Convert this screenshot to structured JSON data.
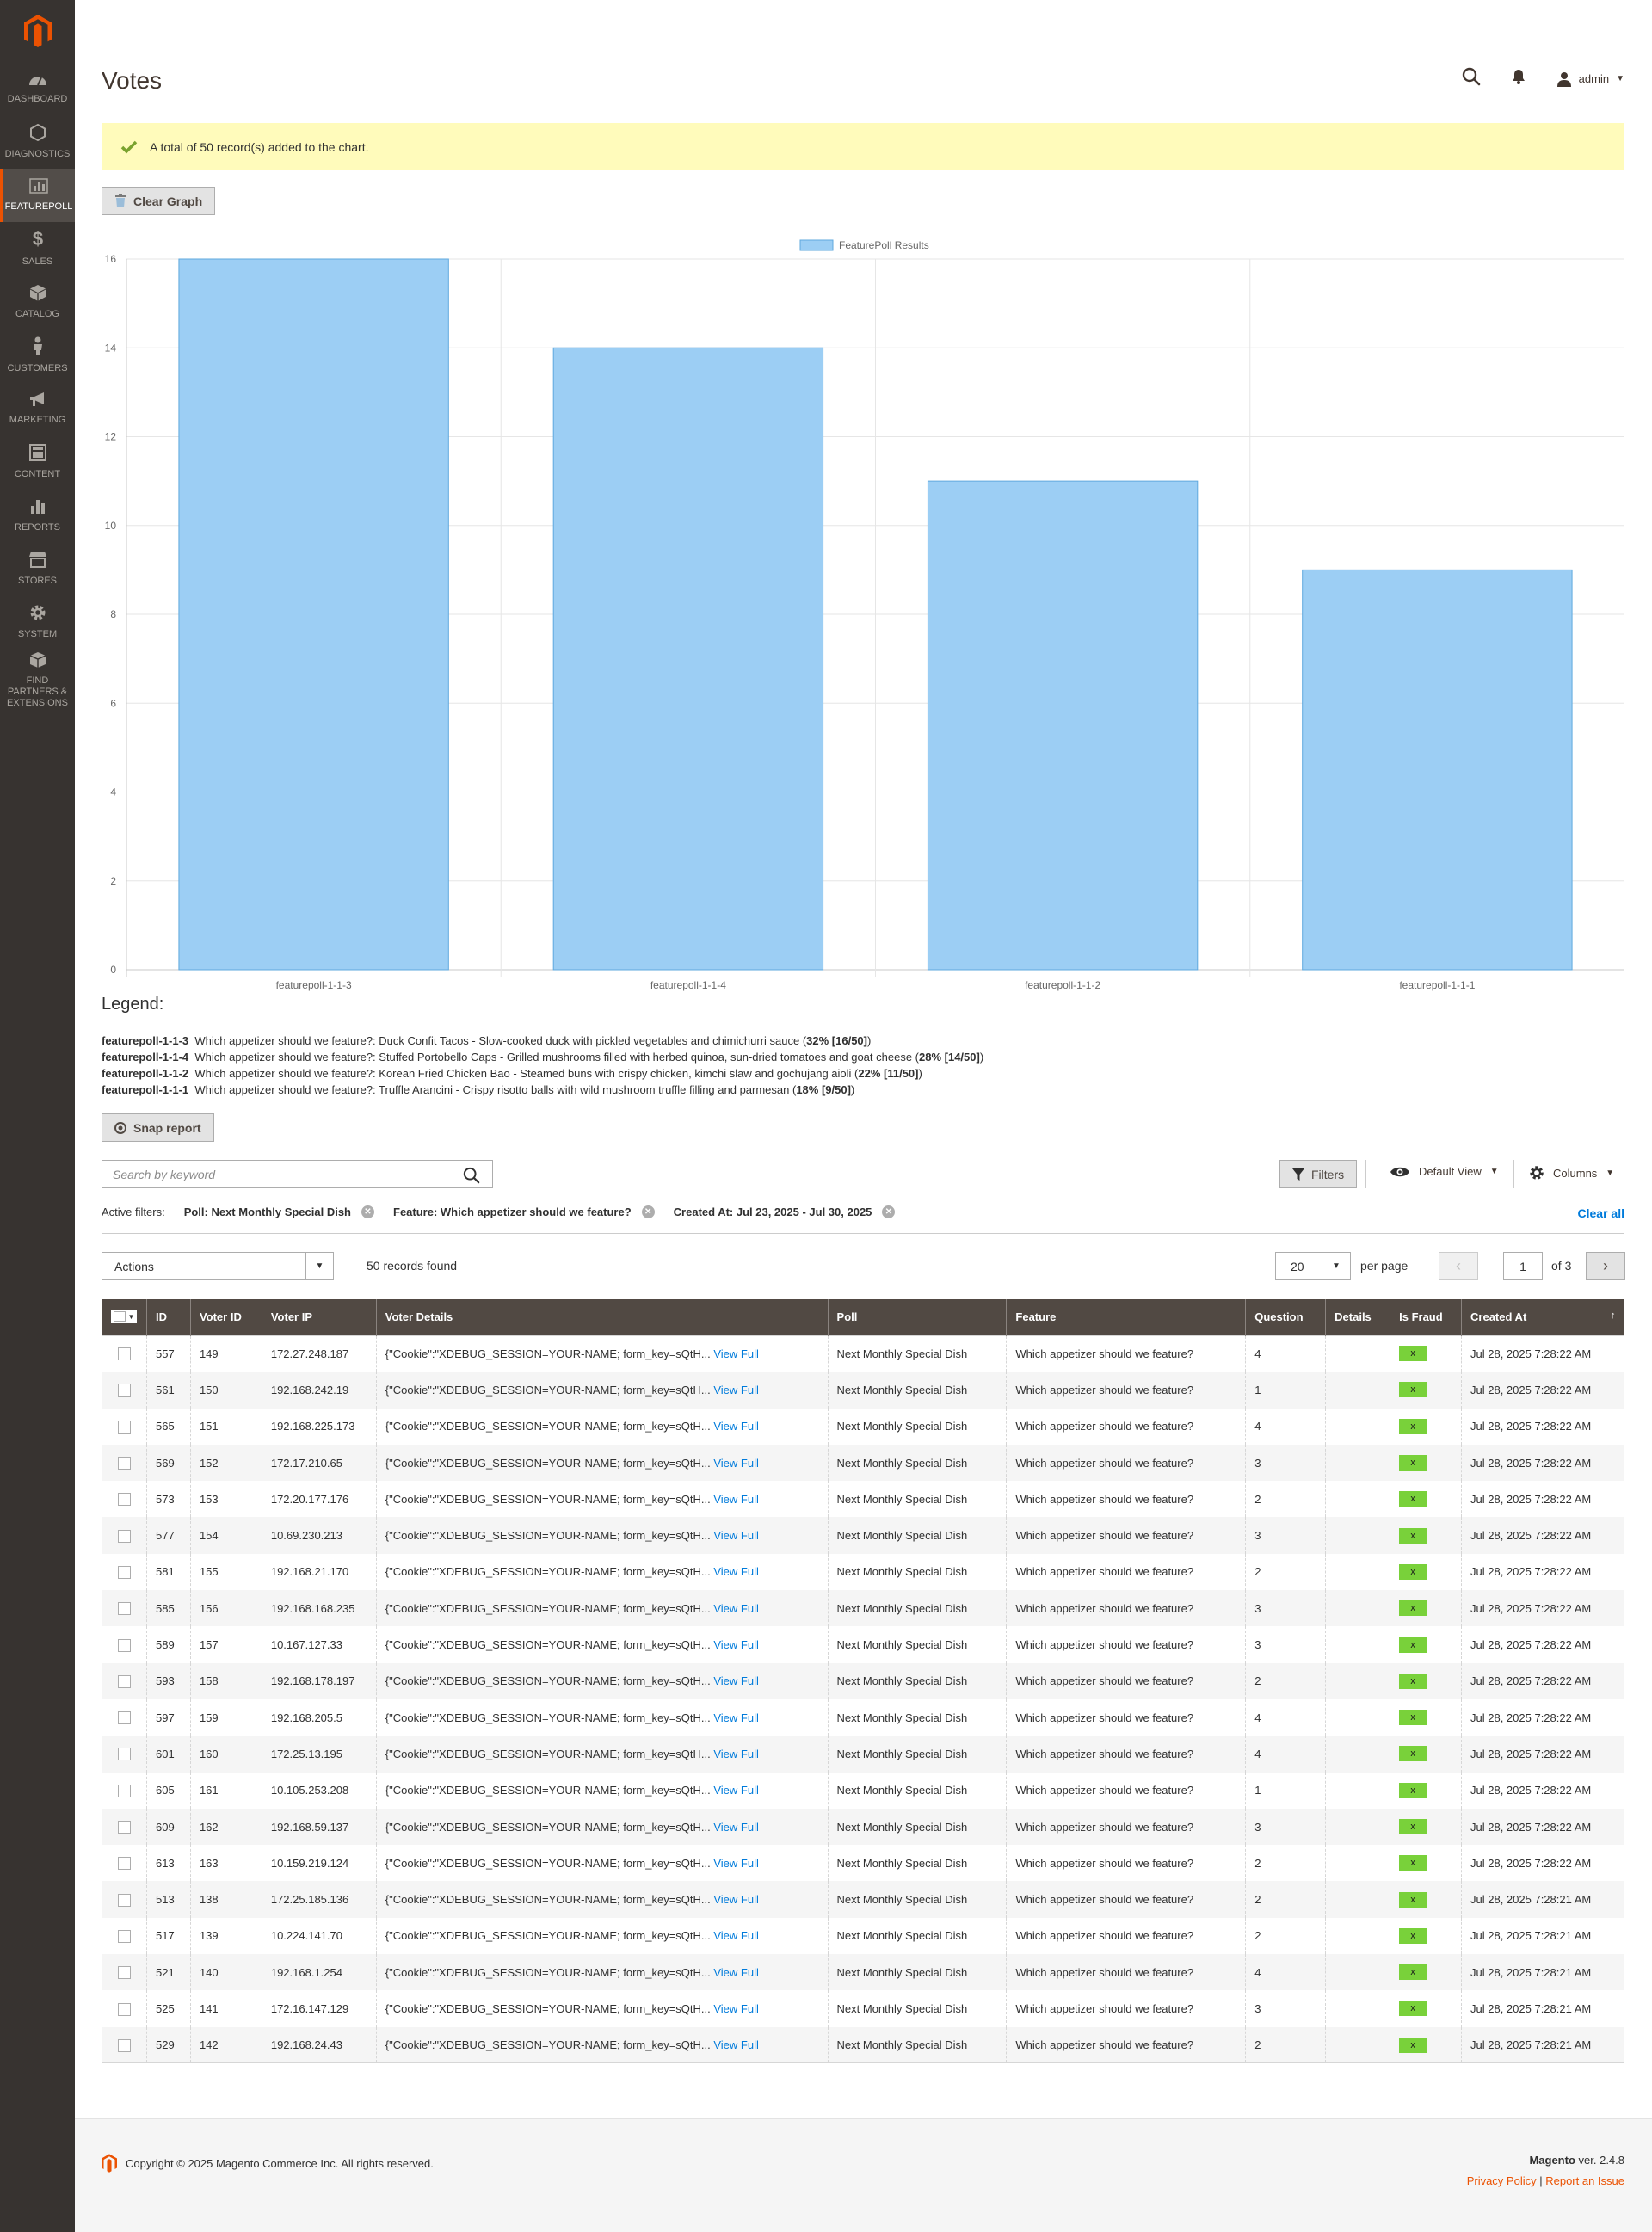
{
  "sidebar": {
    "items": [
      {
        "label": "Dashboard",
        "icon": "dashboard-icon"
      },
      {
        "label": "Diagnostics",
        "icon": "hexagon-icon"
      },
      {
        "label": "Featurepoll",
        "icon": "chart-icon",
        "active": true
      },
      {
        "label": "Sales",
        "icon": "dollar-icon"
      },
      {
        "label": "Catalog",
        "icon": "cube-icon"
      },
      {
        "label": "Customers",
        "icon": "person-icon"
      },
      {
        "label": "Marketing",
        "icon": "megaphone-icon"
      },
      {
        "label": "Content",
        "icon": "content-icon"
      },
      {
        "label": "Reports",
        "icon": "bar-chart-icon"
      },
      {
        "label": "Stores",
        "icon": "store-icon"
      },
      {
        "label": "System",
        "icon": "gear-icon"
      },
      {
        "label": "Find Partners & Extensions",
        "icon": "box-icon"
      }
    ]
  },
  "header": {
    "title": "Votes",
    "user": "admin"
  },
  "message": "A total of 50 record(s) added to the chart.",
  "buttons": {
    "clear_graph": "Clear Graph",
    "snap_report": "Snap report",
    "filters": "Filters"
  },
  "chart_data": {
    "type": "bar",
    "legend": "FeaturePoll Results",
    "categories": [
      "featurepoll-1-1-3",
      "featurepoll-1-1-4",
      "featurepoll-1-1-2",
      "featurepoll-1-1-1"
    ],
    "values": [
      16,
      14,
      11,
      9
    ],
    "ylim": [
      0,
      16
    ],
    "yticks": [
      "0",
      "2",
      "4",
      "6",
      "8",
      "10",
      "12",
      "14",
      "16"
    ],
    "grid": true,
    "legend_position": "top-center",
    "colors": {
      "fill": "#9ccef4",
      "stroke": "#5fa8de"
    }
  },
  "legend": {
    "title": "Legend:",
    "items": [
      {
        "key": "featurepoll-1-1-3",
        "text": "Which appetizer should we feature?: Duck Confit Tacos - Slow-cooked duck with pickled vegetables and chimichurri sauce (",
        "stat": "32% [16/50]",
        "close": ")"
      },
      {
        "key": "featurepoll-1-1-4",
        "text": "Which appetizer should we feature?: Stuffed Portobello Caps - Grilled mushrooms filled with herbed quinoa, sun-dried tomatoes and goat cheese (",
        "stat": "28% [14/50]",
        "close": ")"
      },
      {
        "key": "featurepoll-1-1-2",
        "text": "Which appetizer should we feature?: Korean Fried Chicken Bao - Steamed buns with crispy chicken, kimchi slaw and gochujang aioli (",
        "stat": "22% [11/50]",
        "close": ")"
      },
      {
        "key": "featurepoll-1-1-1",
        "text": "Which appetizer should we feature?: Truffle Arancini - Crispy risotto balls with wild mushroom truffle filling and parmesan (",
        "stat": "18% [9/50]",
        "close": ")"
      }
    ]
  },
  "toolbar": {
    "search_placeholder": "Search by keyword",
    "default_view": "Default View",
    "columns": "Columns"
  },
  "active_filters": {
    "label": "Active filters:",
    "chips": [
      "Poll: Next Monthly Special Dish",
      "Feature: Which appetizer should we feature?",
      "Created At: Jul 23, 2025 - Jul 30, 2025"
    ],
    "clear_all": "Clear all"
  },
  "actions": {
    "label": "Actions",
    "records_found": "50 records found",
    "per_page_value": "20",
    "per_page_label": "per page",
    "page": "1",
    "of": "of 3"
  },
  "table": {
    "columns": [
      "ID",
      "Voter ID",
      "Voter IP",
      "Voter Details",
      "Poll",
      "Feature",
      "Question",
      "Details",
      "Is Fraud",
      "Created At"
    ],
    "sort_indicator": "↑",
    "view_full": "View Full",
    "fraud_label": "x",
    "rows": [
      {
        "id": "557",
        "voter_id": "149",
        "ip": "172.27.248.187",
        "details": "{\"Cookie\":\"XDEBUG_SESSION=YOUR-NAME; form_key=sQtH...",
        "poll": "Next Monthly Special Dish",
        "feature": "Which appetizer should we feature?",
        "question": "4",
        "created": "Jul 28, 2025 7:28:22 AM"
      },
      {
        "id": "561",
        "voter_id": "150",
        "ip": "192.168.242.19",
        "details": "{\"Cookie\":\"XDEBUG_SESSION=YOUR-NAME; form_key=sQtH...",
        "poll": "Next Monthly Special Dish",
        "feature": "Which appetizer should we feature?",
        "question": "1",
        "created": "Jul 28, 2025 7:28:22 AM"
      },
      {
        "id": "565",
        "voter_id": "151",
        "ip": "192.168.225.173",
        "details": "{\"Cookie\":\"XDEBUG_SESSION=YOUR-NAME; form_key=sQtH...",
        "poll": "Next Monthly Special Dish",
        "feature": "Which appetizer should we feature?",
        "question": "4",
        "created": "Jul 28, 2025 7:28:22 AM"
      },
      {
        "id": "569",
        "voter_id": "152",
        "ip": "172.17.210.65",
        "details": "{\"Cookie\":\"XDEBUG_SESSION=YOUR-NAME; form_key=sQtH...",
        "poll": "Next Monthly Special Dish",
        "feature": "Which appetizer should we feature?",
        "question": "3",
        "created": "Jul 28, 2025 7:28:22 AM"
      },
      {
        "id": "573",
        "voter_id": "153",
        "ip": "172.20.177.176",
        "details": "{\"Cookie\":\"XDEBUG_SESSION=YOUR-NAME; form_key=sQtH...",
        "poll": "Next Monthly Special Dish",
        "feature": "Which appetizer should we feature?",
        "question": "2",
        "created": "Jul 28, 2025 7:28:22 AM"
      },
      {
        "id": "577",
        "voter_id": "154",
        "ip": "10.69.230.213",
        "details": "{\"Cookie\":\"XDEBUG_SESSION=YOUR-NAME; form_key=sQtH...",
        "poll": "Next Monthly Special Dish",
        "feature": "Which appetizer should we feature?",
        "question": "3",
        "created": "Jul 28, 2025 7:28:22 AM"
      },
      {
        "id": "581",
        "voter_id": "155",
        "ip": "192.168.21.170",
        "details": "{\"Cookie\":\"XDEBUG_SESSION=YOUR-NAME; form_key=sQtH...",
        "poll": "Next Monthly Special Dish",
        "feature": "Which appetizer should we feature?",
        "question": "2",
        "created": "Jul 28, 2025 7:28:22 AM"
      },
      {
        "id": "585",
        "voter_id": "156",
        "ip": "192.168.168.235",
        "details": "{\"Cookie\":\"XDEBUG_SESSION=YOUR-NAME; form_key=sQtH...",
        "poll": "Next Monthly Special Dish",
        "feature": "Which appetizer should we feature?",
        "question": "3",
        "created": "Jul 28, 2025 7:28:22 AM"
      },
      {
        "id": "589",
        "voter_id": "157",
        "ip": "10.167.127.33",
        "details": "{\"Cookie\":\"XDEBUG_SESSION=YOUR-NAME; form_key=sQtH...",
        "poll": "Next Monthly Special Dish",
        "feature": "Which appetizer should we feature?",
        "question": "3",
        "created": "Jul 28, 2025 7:28:22 AM"
      },
      {
        "id": "593",
        "voter_id": "158",
        "ip": "192.168.178.197",
        "details": "{\"Cookie\":\"XDEBUG_SESSION=YOUR-NAME; form_key=sQtH...",
        "poll": "Next Monthly Special Dish",
        "feature": "Which appetizer should we feature?",
        "question": "2",
        "created": "Jul 28, 2025 7:28:22 AM"
      },
      {
        "id": "597",
        "voter_id": "159",
        "ip": "192.168.205.5",
        "details": "{\"Cookie\":\"XDEBUG_SESSION=YOUR-NAME; form_key=sQtH...",
        "poll": "Next Monthly Special Dish",
        "feature": "Which appetizer should we feature?",
        "question": "4",
        "created": "Jul 28, 2025 7:28:22 AM"
      },
      {
        "id": "601",
        "voter_id": "160",
        "ip": "172.25.13.195",
        "details": "{\"Cookie\":\"XDEBUG_SESSION=YOUR-NAME; form_key=sQtH...",
        "poll": "Next Monthly Special Dish",
        "feature": "Which appetizer should we feature?",
        "question": "4",
        "created": "Jul 28, 2025 7:28:22 AM"
      },
      {
        "id": "605",
        "voter_id": "161",
        "ip": "10.105.253.208",
        "details": "{\"Cookie\":\"XDEBUG_SESSION=YOUR-NAME; form_key=sQtH...",
        "poll": "Next Monthly Special Dish",
        "feature": "Which appetizer should we feature?",
        "question": "1",
        "created": "Jul 28, 2025 7:28:22 AM"
      },
      {
        "id": "609",
        "voter_id": "162",
        "ip": "192.168.59.137",
        "details": "{\"Cookie\":\"XDEBUG_SESSION=YOUR-NAME; form_key=sQtH...",
        "poll": "Next Monthly Special Dish",
        "feature": "Which appetizer should we feature?",
        "question": "3",
        "created": "Jul 28, 2025 7:28:22 AM"
      },
      {
        "id": "613",
        "voter_id": "163",
        "ip": "10.159.219.124",
        "details": "{\"Cookie\":\"XDEBUG_SESSION=YOUR-NAME; form_key=sQtH...",
        "poll": "Next Monthly Special Dish",
        "feature": "Which appetizer should we feature?",
        "question": "2",
        "created": "Jul 28, 2025 7:28:22 AM"
      },
      {
        "id": "513",
        "voter_id": "138",
        "ip": "172.25.185.136",
        "details": "{\"Cookie\":\"XDEBUG_SESSION=YOUR-NAME; form_key=sQtH...",
        "poll": "Next Monthly Special Dish",
        "feature": "Which appetizer should we feature?",
        "question": "2",
        "created": "Jul 28, 2025 7:28:21 AM"
      },
      {
        "id": "517",
        "voter_id": "139",
        "ip": "10.224.141.70",
        "details": "{\"Cookie\":\"XDEBUG_SESSION=YOUR-NAME; form_key=sQtH...",
        "poll": "Next Monthly Special Dish",
        "feature": "Which appetizer should we feature?",
        "question": "2",
        "created": "Jul 28, 2025 7:28:21 AM"
      },
      {
        "id": "521",
        "voter_id": "140",
        "ip": "192.168.1.254",
        "details": "{\"Cookie\":\"XDEBUG_SESSION=YOUR-NAME; form_key=sQtH...",
        "poll": "Next Monthly Special Dish",
        "feature": "Which appetizer should we feature?",
        "question": "4",
        "created": "Jul 28, 2025 7:28:21 AM"
      },
      {
        "id": "525",
        "voter_id": "141",
        "ip": "172.16.147.129",
        "details": "{\"Cookie\":\"XDEBUG_SESSION=YOUR-NAME; form_key=sQtH...",
        "poll": "Next Monthly Special Dish",
        "feature": "Which appetizer should we feature?",
        "question": "3",
        "created": "Jul 28, 2025 7:28:21 AM"
      },
      {
        "id": "529",
        "voter_id": "142",
        "ip": "192.168.24.43",
        "details": "{\"Cookie\":\"XDEBUG_SESSION=YOUR-NAME; form_key=sQtH...",
        "poll": "Next Monthly Special Dish",
        "feature": "Which appetizer should we feature?",
        "question": "2",
        "created": "Jul 28, 2025 7:28:21 AM"
      }
    ]
  },
  "footer": {
    "copyright": "Copyright © 2025 Magento Commerce Inc. All rights reserved.",
    "brand": "Magento",
    "version": " ver. 2.4.8",
    "privacy": "Privacy Policy",
    "separator": " | ",
    "report": "Report an Issue"
  }
}
